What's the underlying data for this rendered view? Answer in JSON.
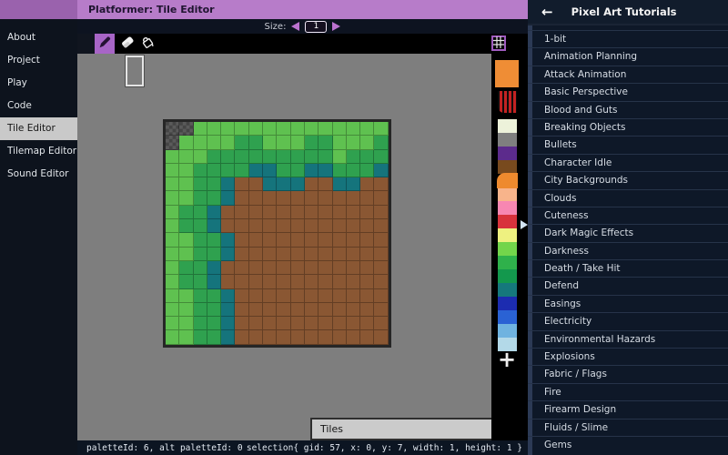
{
  "app_title": "Platformer: Tile Editor",
  "sidebar": {
    "items": [
      {
        "label": "About",
        "selected": false
      },
      {
        "label": "Project",
        "selected": false
      },
      {
        "label": "Play",
        "selected": false
      },
      {
        "label": "Code",
        "selected": false
      },
      {
        "label": "Tile Editor",
        "selected": true
      },
      {
        "label": "Tilemap Editor",
        "selected": false
      },
      {
        "label": "Sound Editor",
        "selected": false
      }
    ]
  },
  "size_control": {
    "label": "Size:",
    "value": "1"
  },
  "toolbar": {
    "tools": [
      {
        "name": "pencil",
        "selected": true
      },
      {
        "name": "eraser",
        "selected": false
      },
      {
        "name": "fill-bucket",
        "selected": false
      }
    ],
    "grid_toggle_icon": "tile-borders-grid"
  },
  "canvas": {
    "grid": {
      "columns": 16,
      "rows": 16,
      "cell_colors": {
        "T": "transparent-checker",
        "L": "#5fc150",
        "M": "#2fa14f",
        "D": "#15747c",
        "B": "#8a5733"
      },
      "map": [
        "TTLLLLLLLLLLLLLL",
        "TLLLLMMLLLMMLLLM",
        "LLLMMMMMMMMMLMMM",
        "LLMMMMDDMMDDMMMD",
        "LLMMDBBDDDBBDDBB",
        "LLMMDBBBBBBBBBBB",
        "LMMDBBBBBBBBBBBB",
        "LMMDBBBBBBBBBBBB",
        "LLMMDBBBBBBBBBBB",
        "LLMMDBBBBBBBBBBB",
        "LMMDBBBBBBBBBBBB",
        "LMMDBBBBBBBBBBBB",
        "LLMMDBBBBBBBBBBB",
        "LLMMDBBBBBBBBBBB",
        "LLMMDBBBBBBBBBBB",
        "LLMMDBBBBBBBBBBB"
      ]
    }
  },
  "palette": {
    "current_color": "#ef8d35",
    "pattern_swatch": "black-red-stripes",
    "selected_index": 4,
    "swatches": [
      "#edf2da",
      "#7f7f7f",
      "#5c2b8c",
      "#784a1e",
      "#ee8a2e",
      "#f8b48b",
      "#f787b2",
      "#d8333c",
      "#eef180",
      "#73d54b",
      "#2fb14b",
      "#13984d",
      "#15787c",
      "#1c2cb0",
      "#2a62d4",
      "#6fb3e0",
      "#b3d9e8"
    ],
    "add_label": "+"
  },
  "tiles_panel": {
    "label": "Tiles"
  },
  "status_bar": {
    "left": "paletteId: 6, alt paletteId: 0",
    "right": "selection{ gid: 57, x: 0, y: 7, width: 1, height: 1 }"
  },
  "right_panel": {
    "back_icon": "←",
    "title": "Pixel Art Tutorials",
    "items": [
      "1-bit",
      "Animation Planning",
      "Attack Animation",
      "Basic Perspective",
      "Blood and Guts",
      "Breaking Objects",
      "Bullets",
      "Character Idle",
      "City Backgrounds",
      "Clouds",
      "Cuteness",
      "Dark Magic Effects",
      "Darkness",
      "Death / Take Hit",
      "Defend",
      "Easings",
      "Electricity",
      "Environmental Hazards",
      "Explosions",
      "Fabric / Flags",
      "Fire",
      "Firearm Design",
      "Fluids / Slime",
      "Gems"
    ]
  }
}
